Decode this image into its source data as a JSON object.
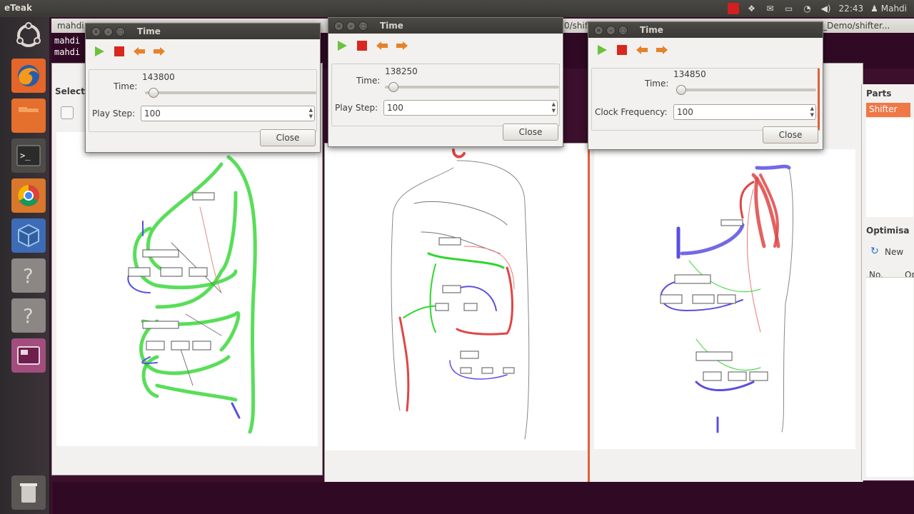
{
  "top_panel": {
    "app_title": "eTeak",
    "clock": "22:43",
    "user": "Mahdi"
  },
  "launcher": {
    "items": [
      "ubuntu-logo-icon",
      "firefox-icon",
      "files-icon",
      "terminal-icon",
      "chrome-icon",
      "virtualbox-icon",
      "unknown-app-icon",
      "unknown-app-icon",
      "workspace-switcher-icon",
      "trash-icon"
    ]
  },
  "terminal": {
    "tab_text": "mahdi",
    "path_right": "_Demo/shifter...",
    "path_mid": "0/shif",
    "line1": "mahdi",
    "line2": "mahdi"
  },
  "left_window": {
    "select_label": "Select"
  },
  "dialogs": [
    {
      "title": "Time",
      "time_label": "Time:",
      "time_value": "143800",
      "step_label": "Play Step:",
      "step_value": "100",
      "close_label": "Close",
      "slider_fraction": 0.02
    },
    {
      "title": "Time",
      "time_label": "Time:",
      "time_value": "138250",
      "step_label": "Play Step:",
      "step_value": "100",
      "close_label": "Close",
      "slider_fraction": 0.02
    },
    {
      "title": "Time",
      "time_label": "Time:",
      "time_value": "134850",
      "step_label": "Clock Frequency:",
      "step_value": "100",
      "close_label": "Close",
      "slider_fraction": 0.0
    }
  ],
  "parts_panel": {
    "header": "Parts",
    "selected": "Shifter",
    "optim_header": "Optimisa",
    "new_label": "New",
    "col_no": "No.",
    "col_op": "Op"
  },
  "colors": {
    "wire_green": "#2fd62f",
    "wire_blue": "#5a4fe0",
    "wire_red": "#e04545",
    "accent_orange": "#f07746",
    "play_green": "#6cc23a",
    "stop_red": "#d9271e"
  }
}
